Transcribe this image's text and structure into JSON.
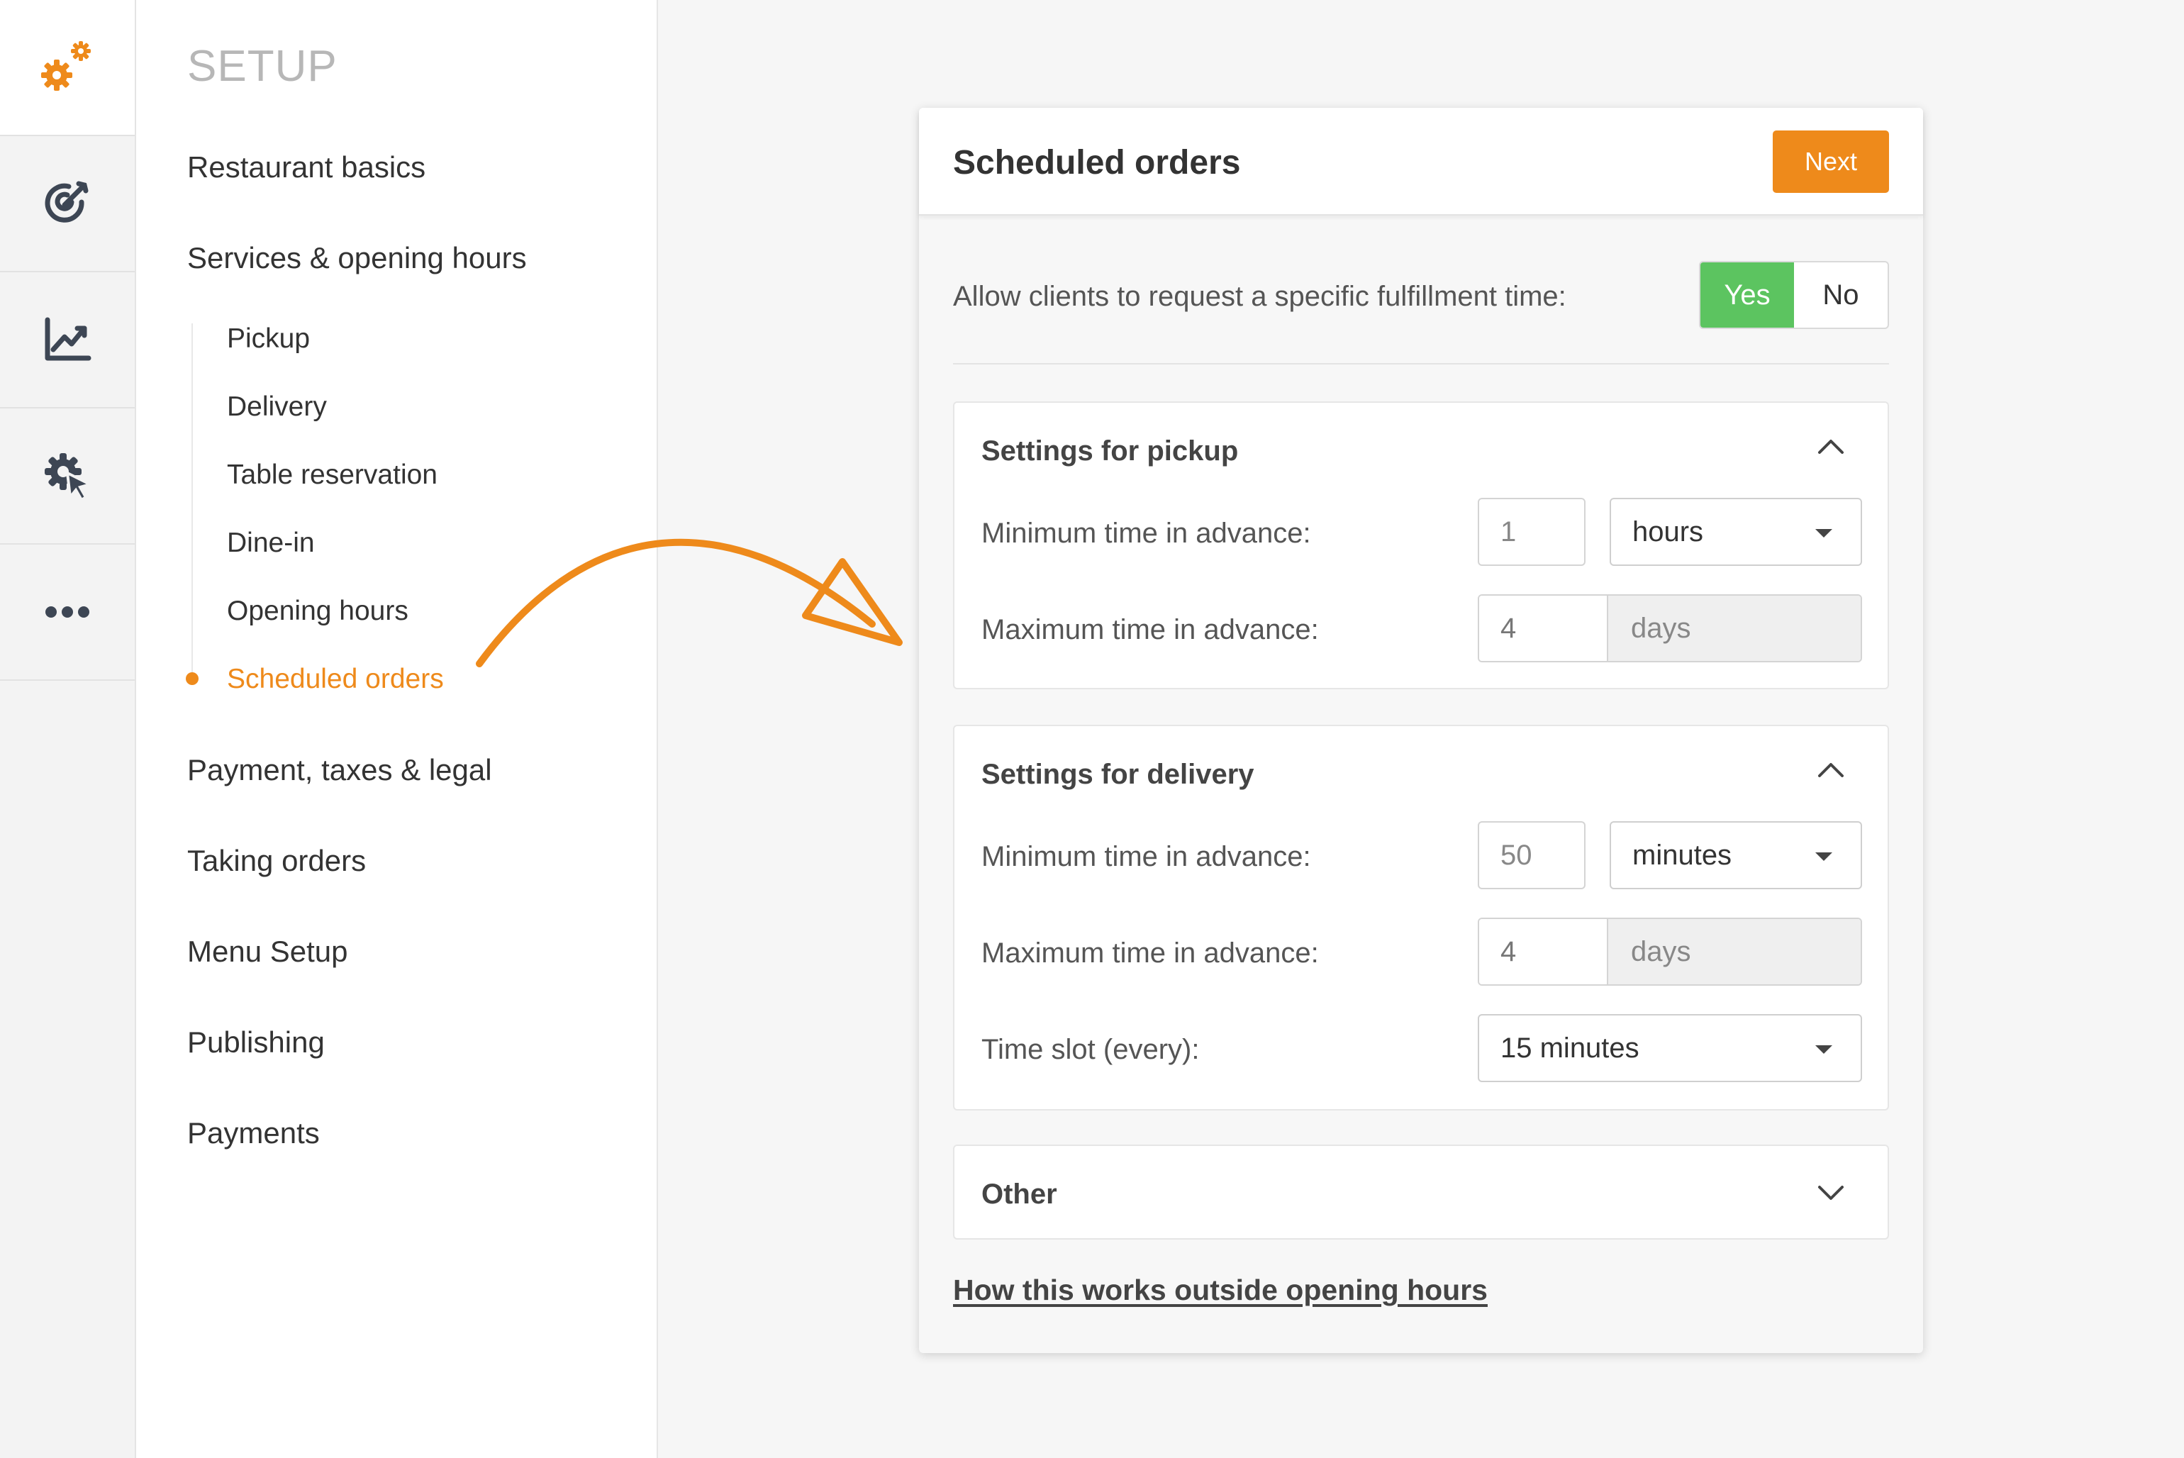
{
  "sidebar": {
    "title": "SETUP",
    "items": [
      {
        "label": "Restaurant basics"
      },
      {
        "label": "Services & opening hours"
      },
      {
        "label": "Payment, taxes & legal"
      },
      {
        "label": "Taking orders"
      },
      {
        "label": "Menu Setup"
      },
      {
        "label": "Publishing"
      },
      {
        "label": "Payments"
      }
    ],
    "subitems": [
      {
        "label": "Pickup"
      },
      {
        "label": "Delivery"
      },
      {
        "label": "Table reservation"
      },
      {
        "label": "Dine-in"
      },
      {
        "label": "Opening hours"
      },
      {
        "label": "Scheduled orders",
        "active": true
      }
    ]
  },
  "rail": {
    "icons": [
      "setup-gears-icon",
      "target-icon",
      "chart-icon",
      "gear-cursor-icon",
      "more-icon"
    ],
    "active": "setup-gears-icon"
  },
  "panel": {
    "title": "Scheduled orders",
    "next_label": "Next",
    "allow_label": "Allow clients to request a specific fulfillment time:",
    "toggle": {
      "yes": "Yes",
      "no": "No",
      "selected": "Yes"
    },
    "pickup": {
      "title": "Settings for pickup",
      "min_label": "Minimum time in advance:",
      "min_value": "1",
      "min_unit": "hours",
      "max_label": "Maximum time in advance:",
      "max_value": "4",
      "max_unit": "days"
    },
    "delivery": {
      "title": "Settings for delivery",
      "min_label": "Minimum time in advance:",
      "min_value": "50",
      "min_unit": "minutes",
      "max_label": "Maximum time in advance:",
      "max_value": "4",
      "max_unit": "days",
      "slot_label": "Time slot (every):",
      "slot_value": "15 minutes"
    },
    "other": {
      "title": "Other"
    },
    "help_link": "How this works outside opening hours"
  },
  "colors": {
    "accent": "#ee8a1b",
    "toggle_on": "#5cc460",
    "text": "#333333"
  }
}
